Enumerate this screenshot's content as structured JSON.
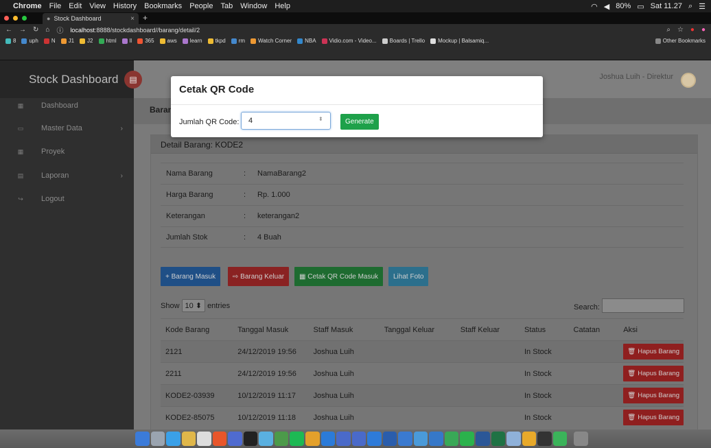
{
  "macbar": {
    "apple": "",
    "app": "Chrome",
    "menus": [
      "File",
      "Edit",
      "View",
      "History",
      "Bookmarks",
      "People",
      "Tab",
      "Window",
      "Help"
    ],
    "battery": "80%",
    "clock": "Sat 11.27"
  },
  "browser": {
    "tab_title": "Stock Dashboard",
    "tab_close": "×",
    "new_tab": "+",
    "url_host": "localhost",
    "url_rest": ":8888/stockdashboard//barang/detail/2",
    "bookmarks": [
      "8",
      "uph",
      "N",
      "J1",
      "J2",
      "html",
      "ll",
      "365",
      "aws",
      "learn",
      "tkpd",
      "rm",
      "Watch Corner",
      "NBA",
      "Vidio.com - Video...",
      "Boards | Trello",
      "Mockup | Balsamiq..."
    ],
    "other_bookmarks": "Other Bookmarks"
  },
  "sidebar": {
    "brand": "Stock Dashboard",
    "items": [
      {
        "label": "Dashboard",
        "chevron": ""
      },
      {
        "label": "Master Data",
        "chevron": "›"
      },
      {
        "label": "Proyek",
        "chevron": ""
      },
      {
        "label": "Laporan",
        "chevron": "›"
      },
      {
        "label": "Logout",
        "chevron": ""
      }
    ]
  },
  "header": {
    "user": "Joshua Luih - Direktur",
    "breadcrumb": "Baran"
  },
  "detail": {
    "title": "Detail Barang: KODE2",
    "rows": [
      {
        "label": "Nama Barang",
        "sep": ":",
        "value": "NamaBarang2"
      },
      {
        "label": "Harga Barang",
        "sep": ":",
        "value": "Rp. 1.000"
      },
      {
        "label": "Keterangan",
        "sep": ":",
        "value": "keterangan2"
      },
      {
        "label": "Jumlah Stok",
        "sep": ":",
        "value": "4 Buah"
      }
    ]
  },
  "actions": {
    "masuk": "+ Barang Masuk",
    "keluar": "⇨ Barang Keluar",
    "cetak": "▦ Cetak QR Code Masuk",
    "foto": "Lihat Foto"
  },
  "table": {
    "show": "Show",
    "entries_value": "10",
    "entries": "entries",
    "search": "Search:",
    "headers": [
      "Kode Barang",
      "Tanggal Masuk",
      "Staff Masuk",
      "Tanggal Keluar",
      "Staff Keluar",
      "Status",
      "Catatan",
      "Aksi"
    ],
    "delete_label": "Hapus Barang",
    "rows": [
      {
        "kode": "2121",
        "tgl_masuk": "24/12/2019 19:56",
        "staff_masuk": "Joshua Luih",
        "tgl_keluar": "",
        "staff_keluar": "",
        "status": "In Stock",
        "catatan": ""
      },
      {
        "kode": "2211",
        "tgl_masuk": "24/12/2019 19:56",
        "staff_masuk": "Joshua Luih",
        "tgl_keluar": "",
        "staff_keluar": "",
        "status": "In Stock",
        "catatan": ""
      },
      {
        "kode": "KODE2-03939",
        "tgl_masuk": "10/12/2019 11:17",
        "staff_masuk": "Joshua Luih",
        "tgl_keluar": "",
        "staff_keluar": "",
        "status": "In Stock",
        "catatan": ""
      },
      {
        "kode": "KODE2-85075",
        "tgl_masuk": "10/12/2019 11:18",
        "staff_masuk": "Joshua Luih",
        "tgl_keluar": "",
        "staff_keluar": "",
        "status": "In Stock",
        "catatan": ""
      }
    ]
  },
  "modal": {
    "title": "Cetak QR Code",
    "field_label": "Jumlah QR Code:",
    "field_value": "4",
    "generate": "Generate"
  },
  "colors": {
    "btn_masuk": "#1f4f86",
    "btn_keluar": "#8a2222",
    "btn_cetak": "#1e6b30",
    "btn_foto": "#2c6f8c",
    "generate": "#1ea14a"
  }
}
